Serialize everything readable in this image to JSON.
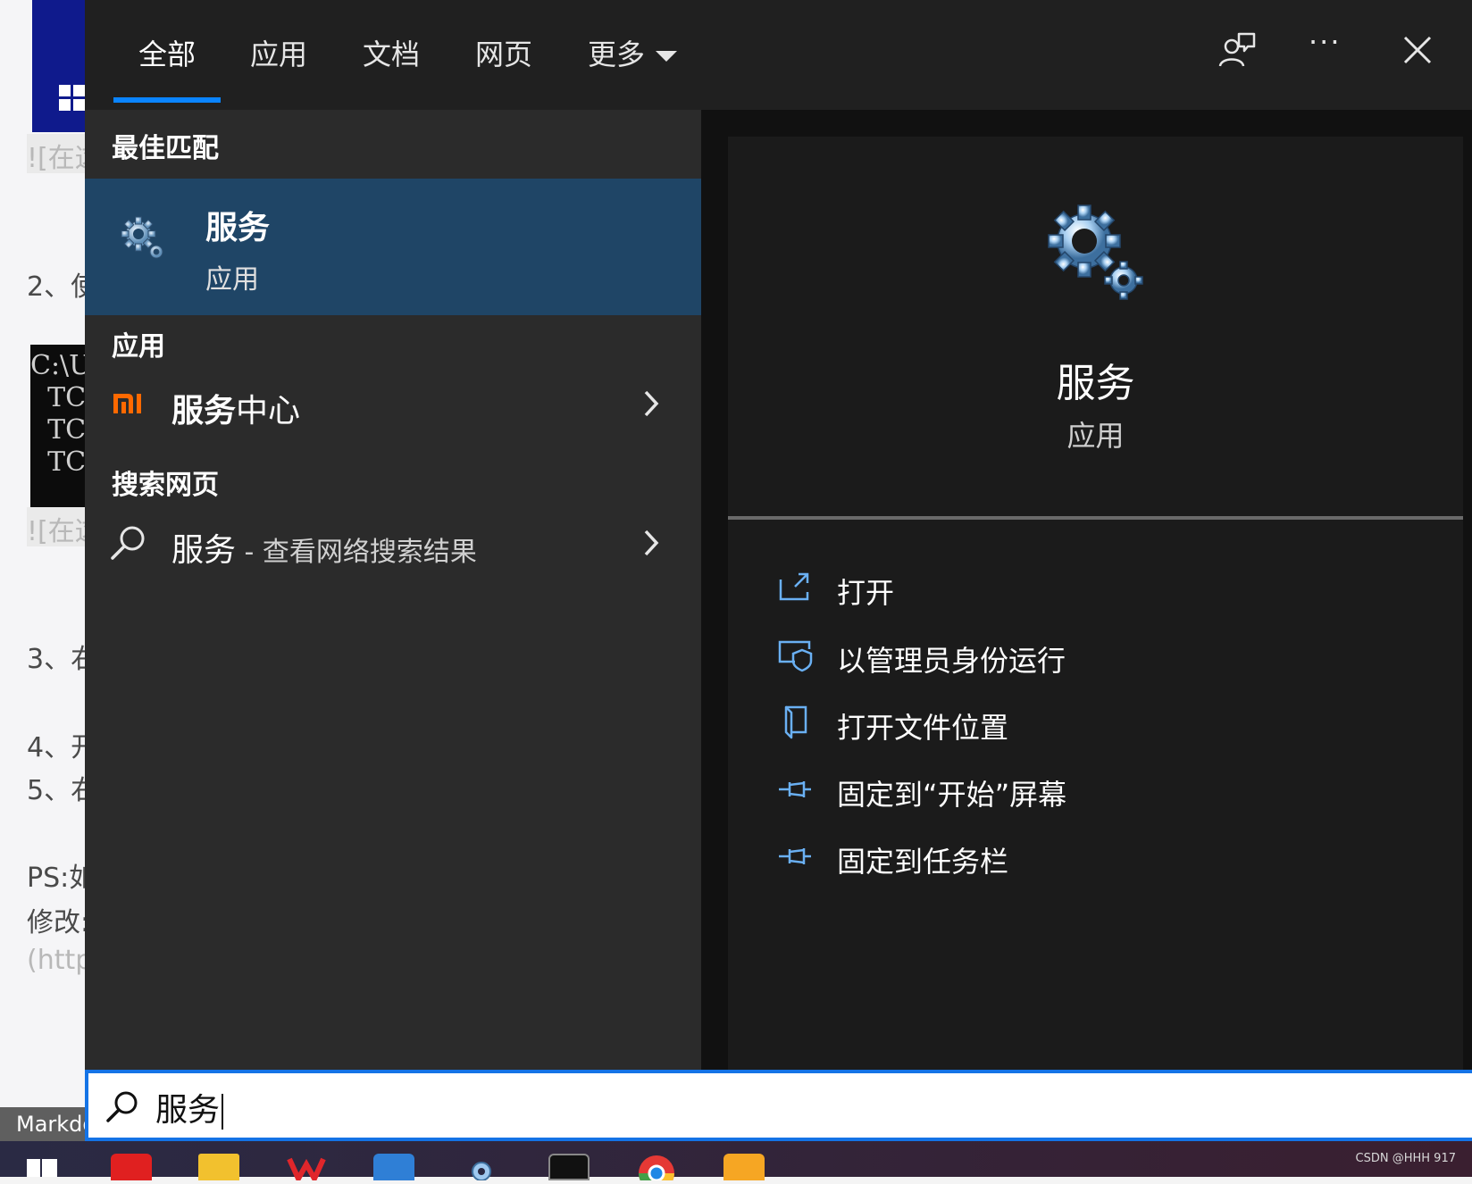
{
  "background_page": {
    "lines": [
      "![在这",
      "2、使",
      "![在这",
      "3、右",
      "4、开",
      "5、右",
      "PS:如",
      "修改:",
      "(http"
    ],
    "terminal_lines": [
      "C:\\U",
      "  TC",
      "  TC",
      "  TC"
    ],
    "status_label": "Markdo"
  },
  "tabs": [
    {
      "label": "全部",
      "active": true
    },
    {
      "label": "应用",
      "active": false
    },
    {
      "label": "文档",
      "active": false
    },
    {
      "label": "网页",
      "active": false
    },
    {
      "label": "更多",
      "active": false
    }
  ],
  "toolbar": {
    "feedback_icon": "feedback-person-icon",
    "more_label": "···",
    "close_icon": "close-icon"
  },
  "results": {
    "best_match_title": "最佳匹配",
    "best_match": {
      "name": "服务",
      "type": "应用",
      "icon": "services-gear-icon"
    },
    "apps_title": "应用",
    "apps": [
      {
        "name_bold": "服务",
        "name_rest": "中心",
        "icon": "mi-logo-icon"
      }
    ],
    "web_title": "搜索网页",
    "web": [
      {
        "query": "服务",
        "suffix": " - 查看网络搜索结果",
        "icon": "search-icon"
      }
    ]
  },
  "detail": {
    "name": "服务",
    "type": "应用",
    "actions": [
      {
        "label": "打开",
        "icon": "open-icon"
      },
      {
        "label": "以管理员身份运行",
        "icon": "run-as-admin-icon"
      },
      {
        "label": "打开文件位置",
        "icon": "file-location-icon"
      },
      {
        "label": "固定到“开始”屏幕",
        "icon": "pin-icon"
      },
      {
        "label": "固定到任务栏",
        "icon": "pin-taskbar-icon"
      }
    ]
  },
  "search": {
    "query": "服务"
  },
  "taskbar": {
    "watermark": "CSDN @HHH 917",
    "items": [
      "start-icon",
      "youdao-icon",
      "file-explorer-icon",
      "wps-icon",
      "vscode-icon",
      "settings-icon",
      "terminal-icon",
      "chrome-icon",
      "app-icon"
    ]
  },
  "colors": {
    "accent": "#0a84ff",
    "selected_row": "#1f4566",
    "mi_orange": "#ff6900",
    "icon_blue": "#6ab0f3"
  }
}
